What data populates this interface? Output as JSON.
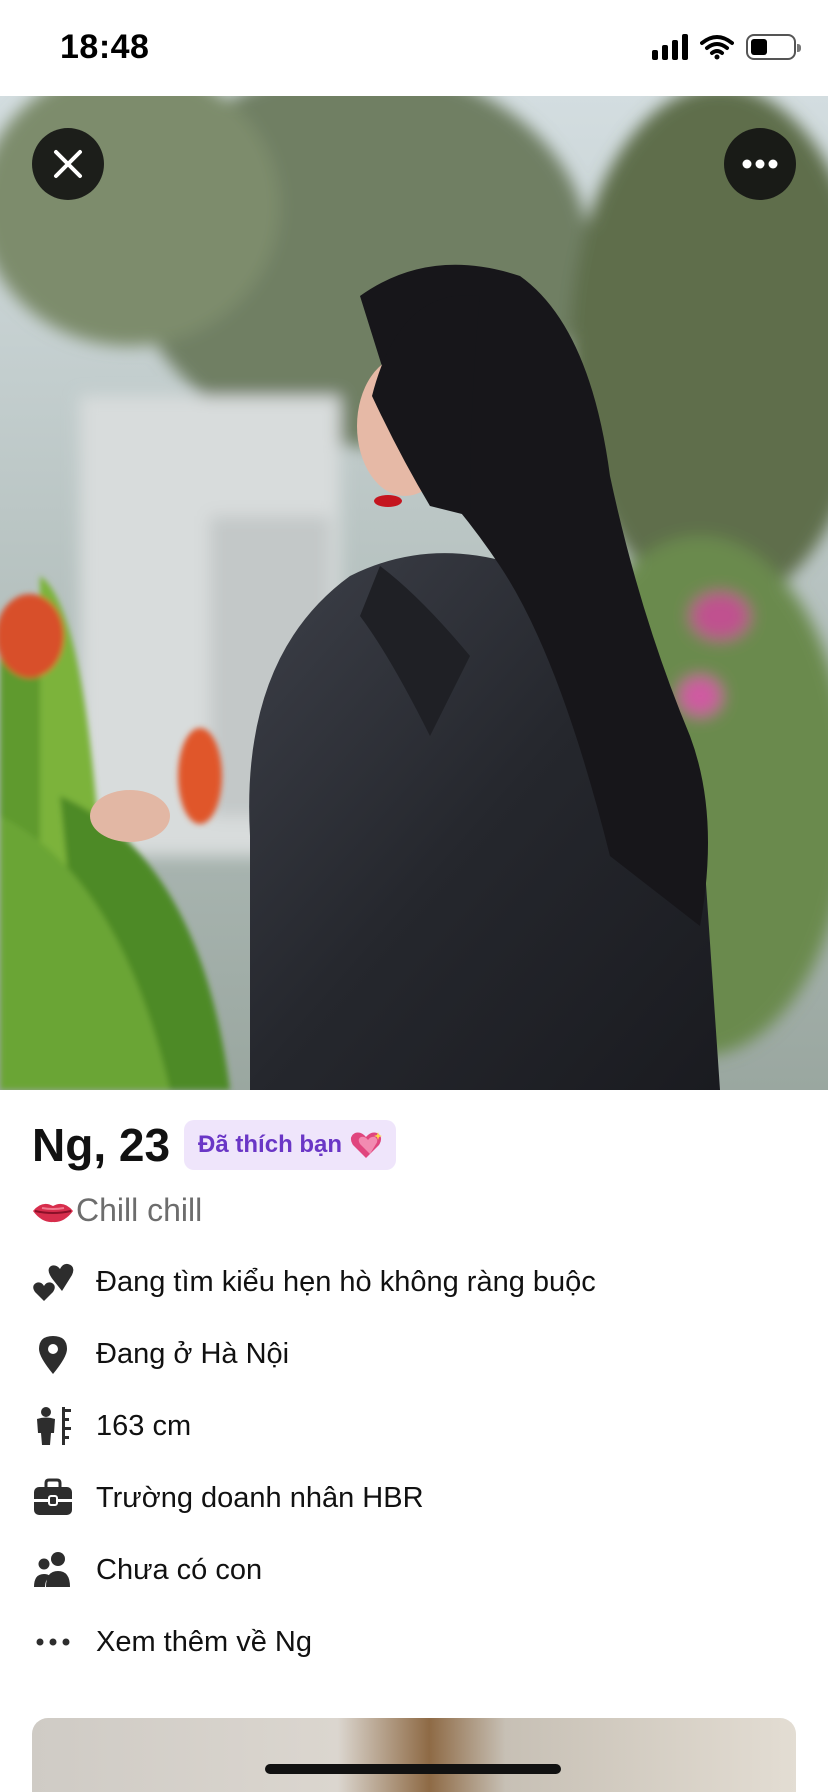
{
  "status": {
    "time": "18:48"
  },
  "profile": {
    "name_age": "Ng, 23",
    "liked_badge": "Đã thích bạn",
    "bio": "Chill chill",
    "details": [
      {
        "icon": "hearts-icon",
        "text": "Đang tìm kiểu hẹn hò không ràng buộc"
      },
      {
        "icon": "location-pin-icon",
        "text": "Đang ở Hà Nội"
      },
      {
        "icon": "height-icon",
        "text": "163 cm"
      },
      {
        "icon": "briefcase-icon",
        "text": "Trường doanh nhân HBR"
      },
      {
        "icon": "people-icon",
        "text": "Chưa có con"
      },
      {
        "icon": "ellipsis-icon",
        "text": "Xem thêm về Ng"
      }
    ]
  },
  "colors": {
    "badge_bg": "#efe5fb",
    "badge_text": "#6a36c6",
    "photo_button": "#121212"
  }
}
